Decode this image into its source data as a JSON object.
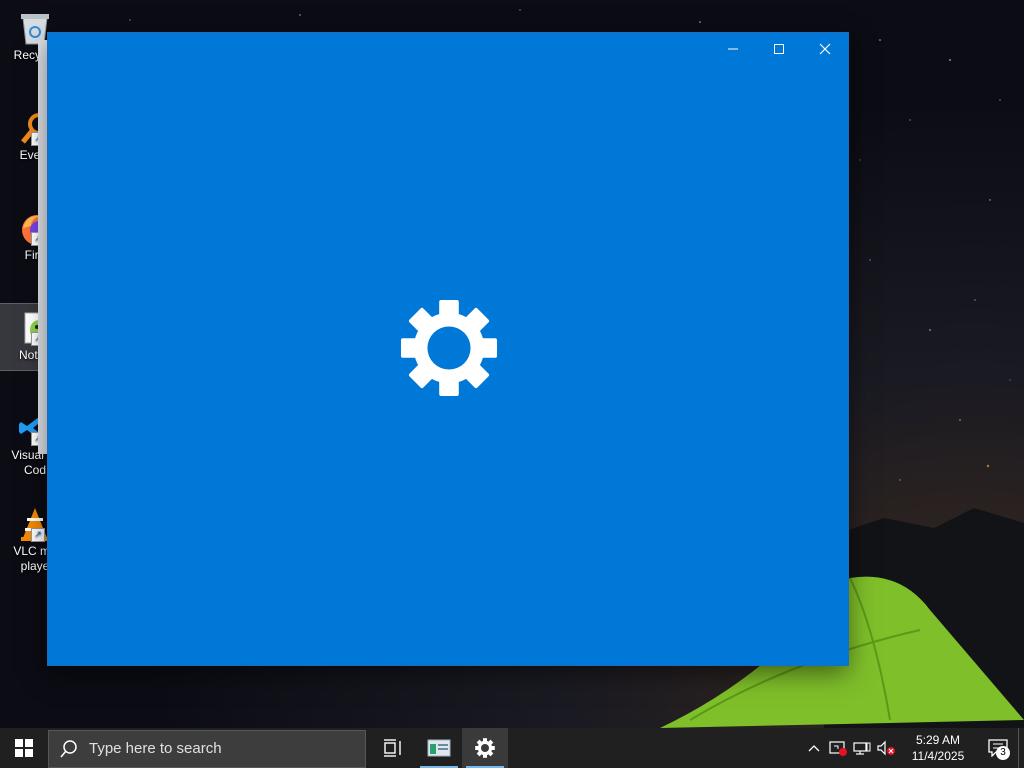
{
  "desktop": {
    "icons": [
      {
        "label": "Recycle",
        "icon": "recycle-bin-icon"
      },
      {
        "label": "Every",
        "icon": "everything-icon"
      },
      {
        "label": "Fire",
        "icon": "firefox-icon"
      },
      {
        "label": "Notep",
        "icon": "notepad-plus-plus-icon"
      },
      {
        "label": "Visual St Cod",
        "icon": "vscode-icon"
      },
      {
        "label": "VLC me playe",
        "icon": "vlc-icon"
      }
    ]
  },
  "window": {
    "app": "Settings",
    "splash_icon": "gear-icon",
    "background": "#0078d7",
    "controls": {
      "minimize": "minimize-icon",
      "maximize": "maximize-icon",
      "close": "close-icon"
    }
  },
  "taskbar": {
    "search_placeholder": "Type here to search",
    "pinned": [
      {
        "name": "task-view",
        "icon": "task-view-icon"
      },
      {
        "name": "app-window",
        "icon": "window-app-icon"
      },
      {
        "name": "settings",
        "icon": "gear-icon",
        "active": true
      }
    ],
    "tray": {
      "icons": [
        "chevron-up-icon",
        "security-icon",
        "network-icon",
        "volume-muted-icon"
      ],
      "time": "5:29 AM",
      "date": "11/4/2025",
      "notification_count": "3"
    }
  },
  "colors": {
    "accent": "#0078d7",
    "taskbar": "#202020",
    "active_underline": "#76b9ed"
  }
}
